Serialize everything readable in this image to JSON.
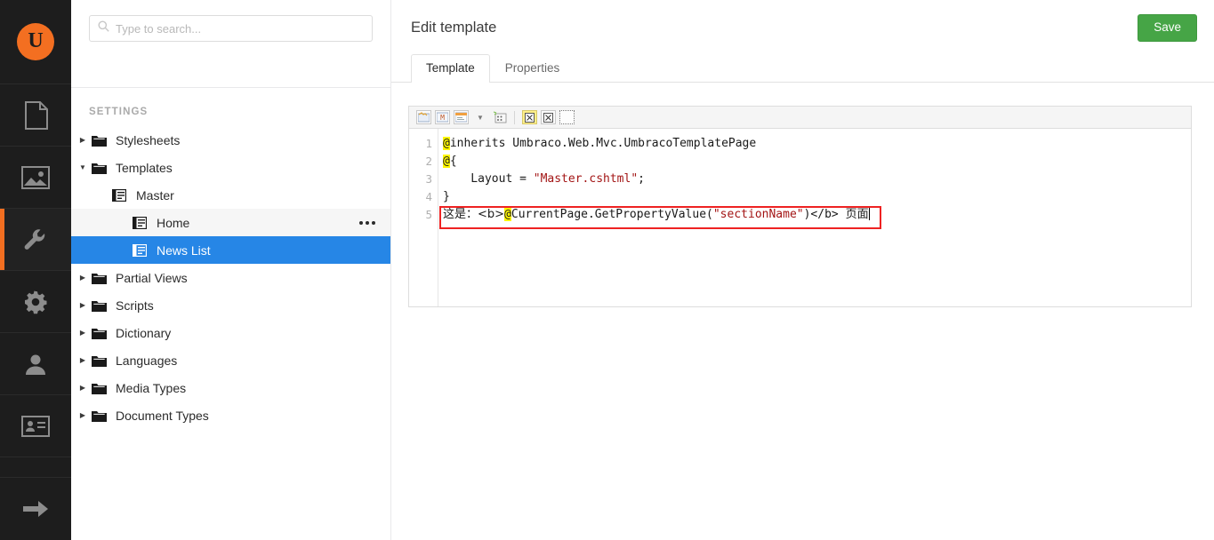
{
  "rail": {
    "logo_letter": "U",
    "logo_name": "umbraco-logo",
    "items": [
      {
        "name": "content-section",
        "icon": "document-icon",
        "label": "Content",
        "active": false
      },
      {
        "name": "media-section",
        "icon": "image-icon",
        "label": "Media",
        "active": false
      },
      {
        "name": "settings-section",
        "icon": "wrench-icon",
        "label": "Settings",
        "active": true
      },
      {
        "name": "developer-section",
        "icon": "gear-icon",
        "label": "Developer",
        "active": false
      },
      {
        "name": "users-section",
        "icon": "user-icon",
        "label": "Users",
        "active": false
      },
      {
        "name": "members-section",
        "icon": "member-card-icon",
        "label": "Members",
        "active": false
      },
      {
        "name": "logout-section",
        "icon": "arrow-right-icon",
        "label": "Logout",
        "active": false
      }
    ]
  },
  "search": {
    "placeholder": "Type to search...",
    "value": ""
  },
  "tree": {
    "section_title": "SETTINGS",
    "items": [
      {
        "label": "Stylesheets",
        "icon": "folder-icon",
        "depth": 0,
        "arrow": "closed",
        "state": "normal"
      },
      {
        "label": "Templates",
        "icon": "folder-icon",
        "depth": 0,
        "arrow": "open",
        "state": "normal"
      },
      {
        "label": "Master",
        "icon": "template-icon",
        "depth": 1,
        "arrow": "none",
        "state": "normal"
      },
      {
        "label": "Home",
        "icon": "template-icon",
        "depth": 2,
        "arrow": "none",
        "state": "hover",
        "menu": "options-ellipsis"
      },
      {
        "label": "News List",
        "icon": "template-icon",
        "depth": 2,
        "arrow": "none",
        "state": "selected"
      },
      {
        "label": "Partial Views",
        "icon": "folder-icon",
        "depth": 0,
        "arrow": "closed",
        "state": "normal"
      },
      {
        "label": "Scripts",
        "icon": "folder-icon",
        "depth": 0,
        "arrow": "closed",
        "state": "normal"
      },
      {
        "label": "Dictionary",
        "icon": "folder-icon",
        "depth": 0,
        "arrow": "closed",
        "state": "normal"
      },
      {
        "label": "Languages",
        "icon": "folder-icon",
        "depth": 0,
        "arrow": "closed",
        "state": "normal"
      },
      {
        "label": "Media Types",
        "icon": "folder-icon",
        "depth": 0,
        "arrow": "closed",
        "state": "normal"
      },
      {
        "label": "Document Types",
        "icon": "folder-icon",
        "depth": 0,
        "arrow": "closed",
        "state": "normal"
      }
    ]
  },
  "main": {
    "title": "Edit template",
    "save_label": "Save",
    "tabs": [
      {
        "label": "Template",
        "active": true
      },
      {
        "label": "Properties",
        "active": false
      }
    ]
  },
  "editor": {
    "toolbar_buttons": [
      {
        "name": "insert-umbraco-field-icon",
        "highlight": false
      },
      {
        "name": "insert-macro-icon",
        "highlight": false
      },
      {
        "name": "insert-partial-view-icon",
        "highlight": false
      },
      {
        "name": "dropdown-caret-icon",
        "highlight": false
      },
      {
        "name": "insert-dictionary-item-icon",
        "highlight": false
      },
      {
        "name": "query-builder-icon",
        "highlight": true
      },
      {
        "name": "insert-snippet-icon",
        "highlight": false
      },
      {
        "name": "toggle-mask-icon",
        "highlight": false
      }
    ],
    "line_numbers": [
      "1",
      "2",
      "3",
      "4",
      "5"
    ],
    "lines": [
      {
        "segments": [
          {
            "t": "@",
            "c": "at"
          },
          {
            "t": "inherits Umbraco.Web.Mvc.UmbracoTemplatePage",
            "c": ""
          }
        ]
      },
      {
        "segments": [
          {
            "t": "@",
            "c": "at"
          },
          {
            "t": "{",
            "c": ""
          }
        ]
      },
      {
        "segments": [
          {
            "t": "    Layout = ",
            "c": ""
          },
          {
            "t": "\"Master.cshtml\"",
            "c": "str"
          },
          {
            "t": ";",
            "c": ""
          }
        ]
      },
      {
        "segments": [
          {
            "t": "}",
            "c": ""
          }
        ]
      },
      {
        "segments": [
          {
            "t": "这是：<b>",
            "c": "cjk"
          },
          {
            "t": "@",
            "c": "at"
          },
          {
            "t": "CurrentPage.GetPropertyValue(",
            "c": ""
          },
          {
            "t": "\"sectionName\"",
            "c": "str"
          },
          {
            "t": ")</b> ",
            "c": ""
          },
          {
            "t": "页面",
            "c": "cjk"
          }
        ]
      }
    ],
    "highlight_box_line": 5,
    "highlight_box_color": "#ee2222",
    "cursor_line": 5
  },
  "colors": {
    "brand_orange": "#f36f21",
    "rail_background": "#1d1d1d",
    "selection_blue": "#2686e6",
    "save_green": "#46a546",
    "string_red": "#a31515",
    "at_highlight": "#fff700"
  }
}
